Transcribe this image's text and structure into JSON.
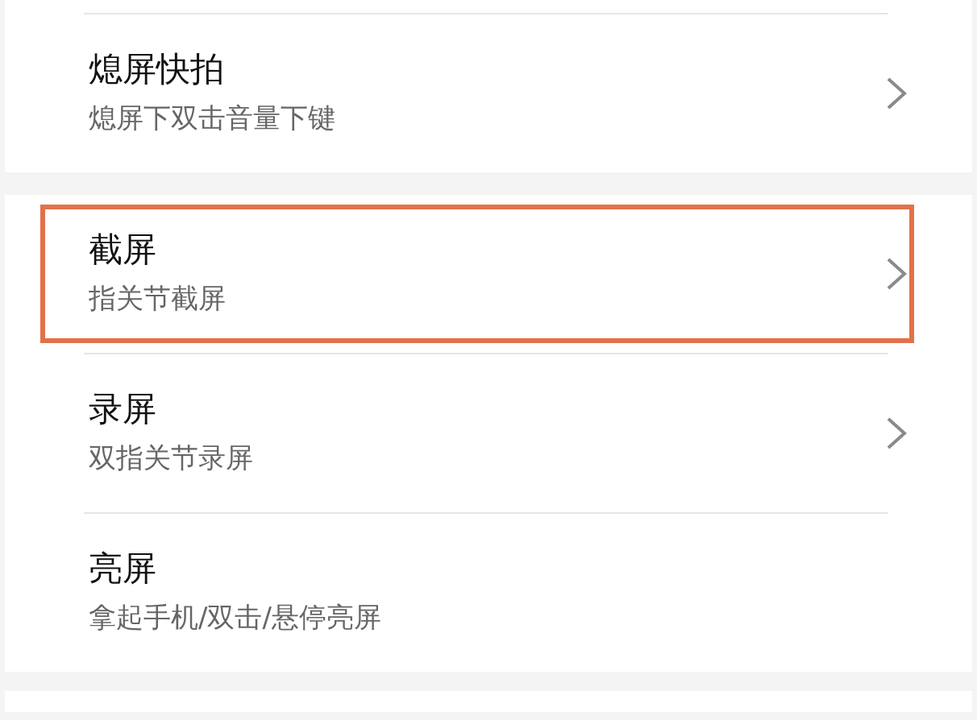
{
  "groups": [
    {
      "items": [
        {
          "title": "熄屏快拍",
          "subtitle": "熄屏下双击音量下键",
          "chevron": true,
          "highlighted": false
        }
      ]
    },
    {
      "items": [
        {
          "title": "截屏",
          "subtitle": "指关节截屏",
          "chevron": true,
          "highlighted": true
        },
        {
          "title": "录屏",
          "subtitle": "双指关节录屏",
          "chevron": true,
          "highlighted": false
        },
        {
          "title": "亮屏",
          "subtitle": "拿起手机/双击/悬停亮屏",
          "chevron": false,
          "highlighted": false
        }
      ]
    }
  ]
}
